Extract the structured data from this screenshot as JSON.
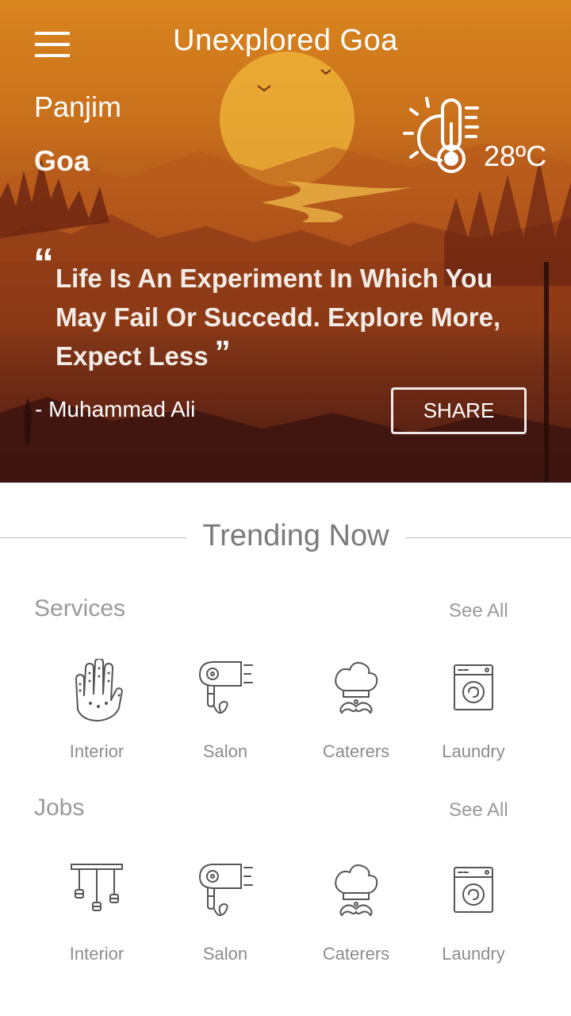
{
  "header": {
    "menu_icon": "hamburger-menu-icon",
    "title": "Unexplored Goa"
  },
  "location": {
    "city": "Panjim",
    "state": "Goa"
  },
  "weather": {
    "icon": "sun-thermometer-icon",
    "temperature": "28ºC"
  },
  "quote": {
    "open_mark": "“",
    "text": "Life Is An Experiment In Which You May Fail Or Succedd. Explore More, Expect Less",
    "close_mark": "”",
    "author": "- Muhammad Ali",
    "share_label": "SHARE"
  },
  "trending": {
    "title": "Trending Now"
  },
  "sections": [
    {
      "title": "Services",
      "see_all": "See All",
      "items": [
        {
          "label": "Interior",
          "icon": "mehndi-hand-icon"
        },
        {
          "label": "Salon",
          "icon": "hair-dryer-icon"
        },
        {
          "label": "Caterers",
          "icon": "chef-hat-icon"
        },
        {
          "label": "Laundry",
          "icon": "washing-machine-icon"
        }
      ]
    },
    {
      "title": "Jobs",
      "see_all": "See All",
      "items": [
        {
          "label": "Interior",
          "icon": "pendant-lamps-icon"
        },
        {
          "label": "Salon",
          "icon": "hair-dryer-icon"
        },
        {
          "label": "Caterers",
          "icon": "chef-hat-icon"
        },
        {
          "label": "Laundry",
          "icon": "washing-machine-icon"
        }
      ]
    }
  ],
  "colors": {
    "hero_top": "#d9851f",
    "hero_bottom": "#4a1a10",
    "text_muted": "#9a9a9a",
    "icon_stroke": "#555555"
  }
}
